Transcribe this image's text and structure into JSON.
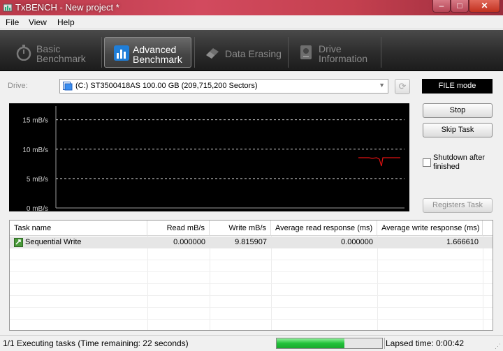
{
  "window": {
    "title": "TxBENCH - New project *",
    "min_glyph": "–",
    "max_glyph": "□",
    "close_glyph": "✕"
  },
  "menu": {
    "items": [
      "File",
      "View",
      "Help"
    ]
  },
  "toolbar": {
    "tabs": [
      {
        "line1": "Basic",
        "line2": "Benchmark",
        "icon": "stopwatch-icon",
        "active": false
      },
      {
        "line1": "Advanced",
        "line2": "Benchmark",
        "icon": "bar-chart-icon",
        "active": true
      },
      {
        "line1": "Data Erasing",
        "line2": "",
        "icon": "eraser-icon",
        "active": false
      },
      {
        "line1": "Drive",
        "line2": "Information",
        "icon": "drive-info-icon",
        "active": false
      }
    ]
  },
  "drive": {
    "label": "Drive:",
    "selected": "(C:) ST3500418AS  100.00 GB (209,715,200 Sectors)",
    "mode": "FILE mode"
  },
  "graph": {
    "y_ticks": [
      "15 mB/s",
      "10 mB/s",
      "5 mB/s",
      "0 mB/s"
    ],
    "y_values": [
      15,
      10,
      5,
      0
    ],
    "trace_color": "#e01010",
    "grid_color": "#cfcfcf"
  },
  "controls": {
    "stop_label": "Stop",
    "skip_label": "Skip Task",
    "shutdown_label": "Shutdown after finished",
    "shutdown_checked": false,
    "registers_label": "Registers Task"
  },
  "tasks": {
    "columns": [
      "Task name",
      "Read mB/s",
      "Write mB/s",
      "Average read response (ms)",
      "Average write response (ms)"
    ],
    "rows": [
      {
        "name": "Sequential Write",
        "read": "0.000000",
        "write": "9.815907",
        "avg_read": "0.000000",
        "avg_write": "1.666610"
      }
    ]
  },
  "status": {
    "text": "1/1 Executing tasks (Time remaining: 22 seconds)",
    "progress": 0.64,
    "lapsed": "Lapsed time: 0:00:42"
  }
}
